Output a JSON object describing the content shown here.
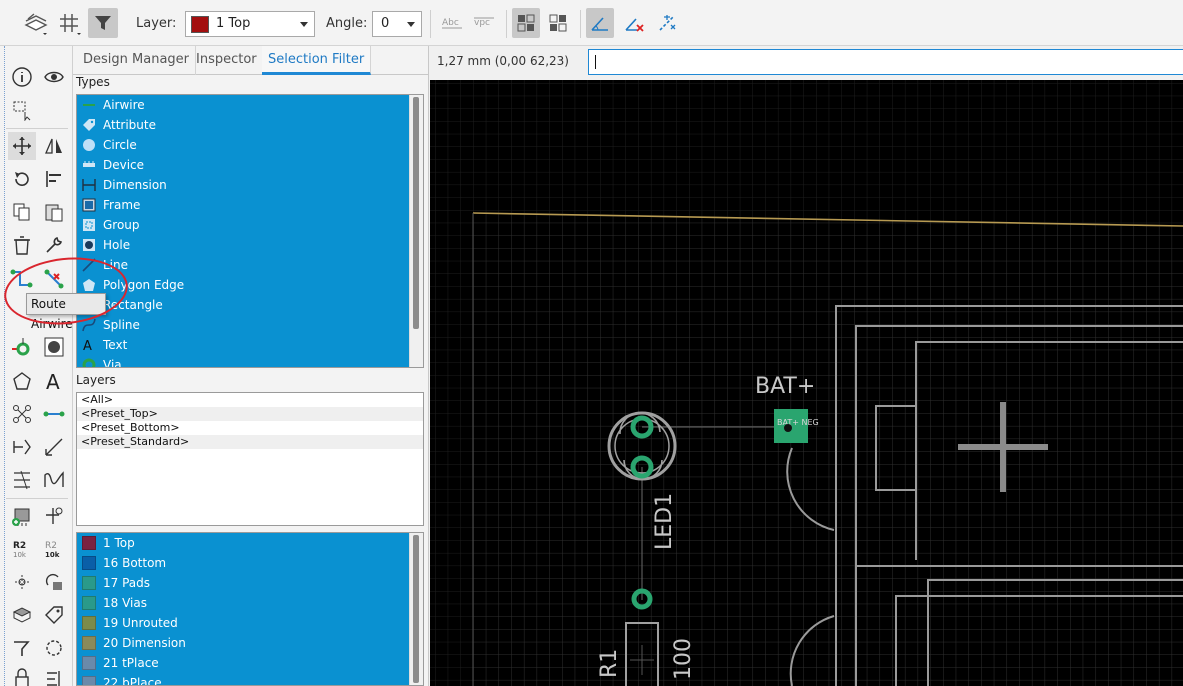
{
  "toolbar": {
    "layer_label": "Layer:",
    "layer_value": "1 Top",
    "angle_label": "Angle:",
    "angle_value": "0",
    "layer_color": "#a30f0f"
  },
  "tabs": [
    "Design Manager",
    "Inspector",
    "Selection Filter"
  ],
  "types_label": "Types",
  "types": [
    {
      "label": "Airwire",
      "icon": "airwire-icon"
    },
    {
      "label": "Attribute",
      "icon": "tag-icon"
    },
    {
      "label": "Circle",
      "icon": "circle-icon"
    },
    {
      "label": "Device",
      "icon": "device-icon"
    },
    {
      "label": "Dimension",
      "icon": "dimension-icon"
    },
    {
      "label": "Frame",
      "icon": "frame-icon"
    },
    {
      "label": "Group",
      "icon": "group-icon"
    },
    {
      "label": "Hole",
      "icon": "hole-icon"
    },
    {
      "label": "Line",
      "icon": "line-icon"
    },
    {
      "label": "Polygon Edge",
      "icon": "polygon-icon"
    },
    {
      "label": "Rectangle",
      "icon": "rectangle-icon"
    },
    {
      "label": "Spline",
      "icon": "spline-icon"
    },
    {
      "label": "Text",
      "icon": "text-icon"
    },
    {
      "label": "Via",
      "icon": "via-icon"
    }
  ],
  "layers_label": "Layers",
  "presets": [
    "<All>",
    "<Preset_Top>",
    "<Preset_Bottom>",
    "<Preset_Standard>"
  ],
  "layers": [
    {
      "label": "1 Top",
      "color": "#7a2240"
    },
    {
      "label": "16 Bottom",
      "color": "#0a5fa8"
    },
    {
      "label": "17 Pads",
      "color": "#2a9a8a"
    },
    {
      "label": "18 Vias",
      "color": "#2a9a8a"
    },
    {
      "label": "19 Unrouted",
      "color": "#7b8b4a"
    },
    {
      "label": "20 Dimension",
      "color": "#8a8a5a"
    },
    {
      "label": "21 tPlace",
      "color": "#6a8aaa"
    },
    {
      "label": "22 bPlace",
      "color": "#6a8aaa"
    }
  ],
  "tooltip": "Route Airwire",
  "coord_readout": "1,27 mm (0,00 62,23)",
  "board": {
    "bat_label": "BAT+",
    "bat_pad_text": "BAT+ NEG",
    "led_name": "LED1",
    "r_name": "R1",
    "r_value": "100"
  },
  "tool_labels": {
    "r2_a": "R2",
    "r2_b": "10k",
    "r2_c": "R2",
    "r2_d": "10k"
  }
}
